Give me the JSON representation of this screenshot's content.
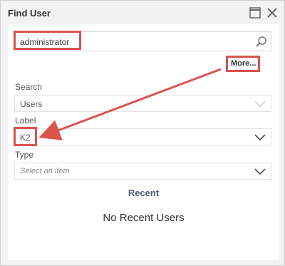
{
  "window": {
    "title": "Find User",
    "controls": [
      "maximize-icon",
      "close-icon"
    ]
  },
  "search": {
    "value": "administrator",
    "icon": "search-icon"
  },
  "more_link": "More...",
  "fields": {
    "search_label": "Search",
    "search_value": "Users",
    "label_label": "Label",
    "label_value": "K2",
    "type_label": "Type",
    "type_placeholder": "Select an item"
  },
  "recent": {
    "title": "Recent",
    "empty_text": "No Recent Users"
  },
  "colors": {
    "highlight": "#d9534f",
    "recent_title": "#4f5a6e"
  }
}
